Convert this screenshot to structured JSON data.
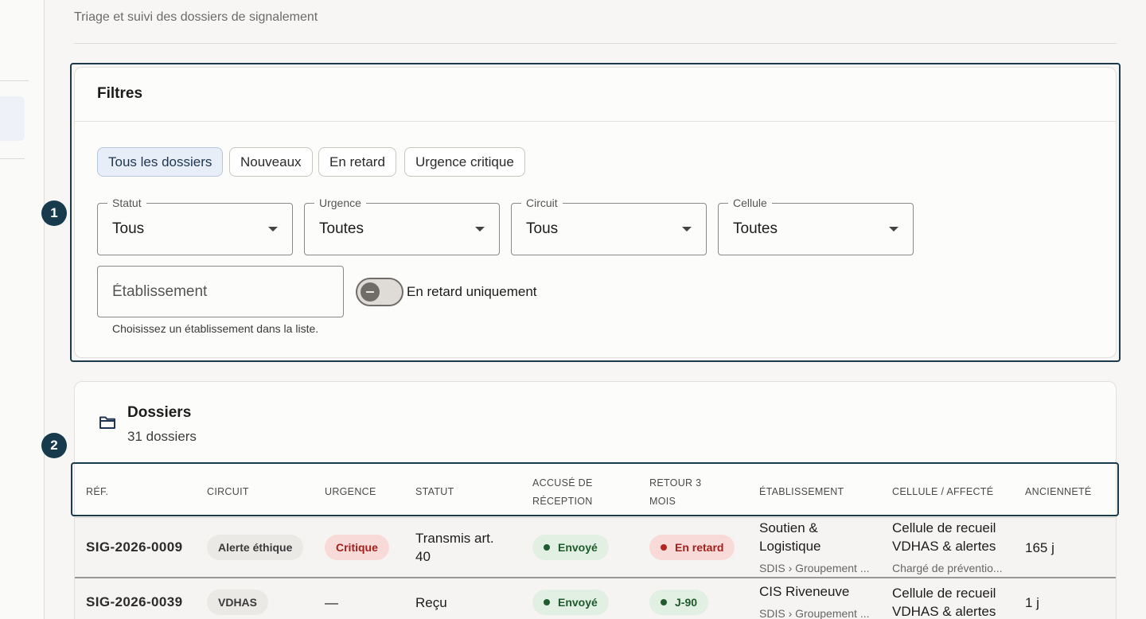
{
  "header": {
    "subtitle": "Triage et suivi des dossiers de signalement"
  },
  "steps": [
    "1",
    "2"
  ],
  "filters": {
    "title": "Filtres",
    "chips": [
      "Tous les dossiers",
      "Nouveaux",
      "En retard",
      "Urgence critique"
    ],
    "selected_chip": "Tous les dossiers",
    "selects": [
      {
        "label": "Statut",
        "value": "Tous"
      },
      {
        "label": "Urgence",
        "value": "Toutes"
      },
      {
        "label": "Circuit",
        "value": "Tous"
      },
      {
        "label": "Cellule",
        "value": "Toutes"
      }
    ],
    "etablissement": {
      "placeholder": "Établissement",
      "value": "",
      "helper": "Choisissez un établissement dans la liste."
    },
    "toggle": {
      "label": "En retard uniquement",
      "checked": false
    }
  },
  "dossiers": {
    "title": "Dossiers",
    "count": "31 dossiers",
    "columns": [
      "Réf.",
      "Circuit",
      "Urgence",
      "Statut",
      "Accusé de réception",
      "Retour 3 mois",
      "Établissement",
      "Cellule / affecté",
      "Ancienneté"
    ],
    "rows": [
      {
        "ref": "SIG-2026-0009",
        "circuit": "Alerte éthique",
        "urgence": "Critique",
        "statut": "Transmis art. 40",
        "accuse": "Envoyé",
        "retour": "En retard",
        "etablissement": "Soutien & Logistique",
        "etablissement_sub": "SDIS › Groupement ...",
        "cellule": "Cellule de recueil VDHAS & alertes",
        "cellule_sub": "Chargé de préventio...",
        "anciennete": "165 j"
      },
      {
        "ref": "SIG-2026-0039",
        "circuit": "VDHAS",
        "urgence": "—",
        "statut": "Reçu",
        "accuse": "Envoyé",
        "retour": "J-90",
        "etablissement": "CIS Riveneuve",
        "etablissement_sub": "SDIS › Groupement ...",
        "cellule": "Cellule de recueil VDHAS & alertes",
        "cellule_sub": "",
        "anciennete": "1 j"
      }
    ]
  },
  "colors": {
    "accent_dark": "#173a4d",
    "chip_selected": "#e7eef8",
    "danger": "#a3201c",
    "success": "#1e5a2b"
  }
}
